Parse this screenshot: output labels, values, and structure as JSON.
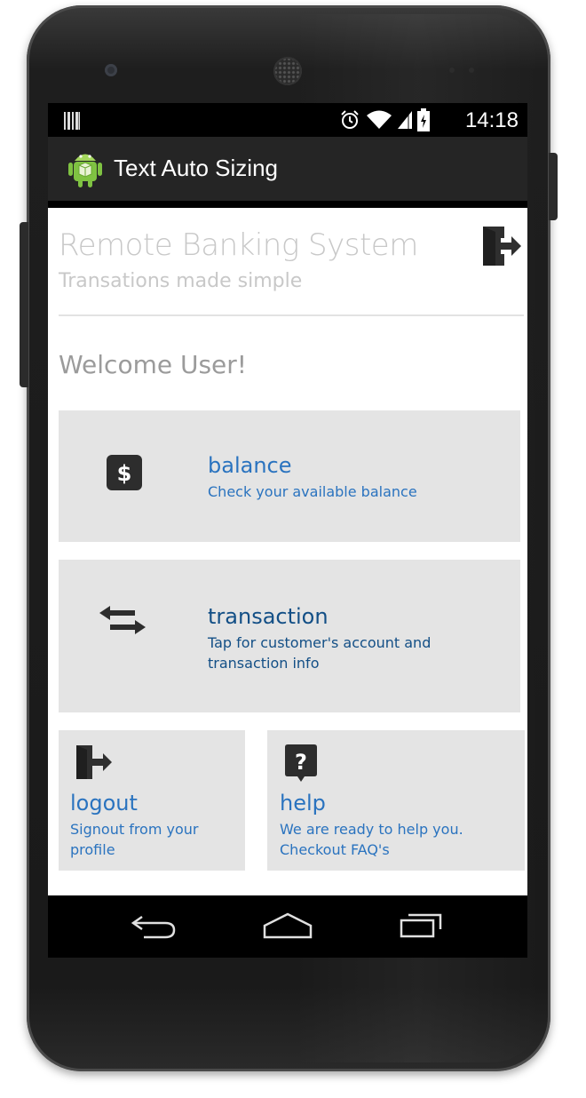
{
  "statusbar": {
    "time": "14:18",
    "icons": [
      "barcode-notification-icon",
      "alarm-icon",
      "wifi-icon",
      "signal-icon",
      "battery-icon"
    ]
  },
  "actionbar": {
    "title": "Text Auto Sizing",
    "icon": "android-icon"
  },
  "header": {
    "title": "Remote Banking System",
    "subtitle": "Transations made simple",
    "exit_icon": "exit-door-icon"
  },
  "welcome": "Welcome User!",
  "tiles": [
    {
      "icon": "dollar-icon",
      "title": "balance",
      "description": "Check your available balance"
    },
    {
      "icon": "transfer-arrows-icon",
      "title": "transaction",
      "description": "Tap for customer's account and transaction info"
    },
    {
      "icon": "exit-door-icon",
      "title": "logout",
      "description": "Signout from your profile"
    },
    {
      "icon": "help-question-icon",
      "title": "help",
      "description": "We are ready to help you. Checkout FAQ's"
    }
  ],
  "navbar": {
    "buttons": [
      "back-icon",
      "home-icon",
      "recents-icon"
    ]
  },
  "colors": {
    "accent_text": "#2a73bf",
    "accent_text_dark": "#134f86",
    "tile_bg": "#e4e4e4",
    "actionbar_bg": "#252525",
    "muted_text": "#c8c8c8"
  }
}
